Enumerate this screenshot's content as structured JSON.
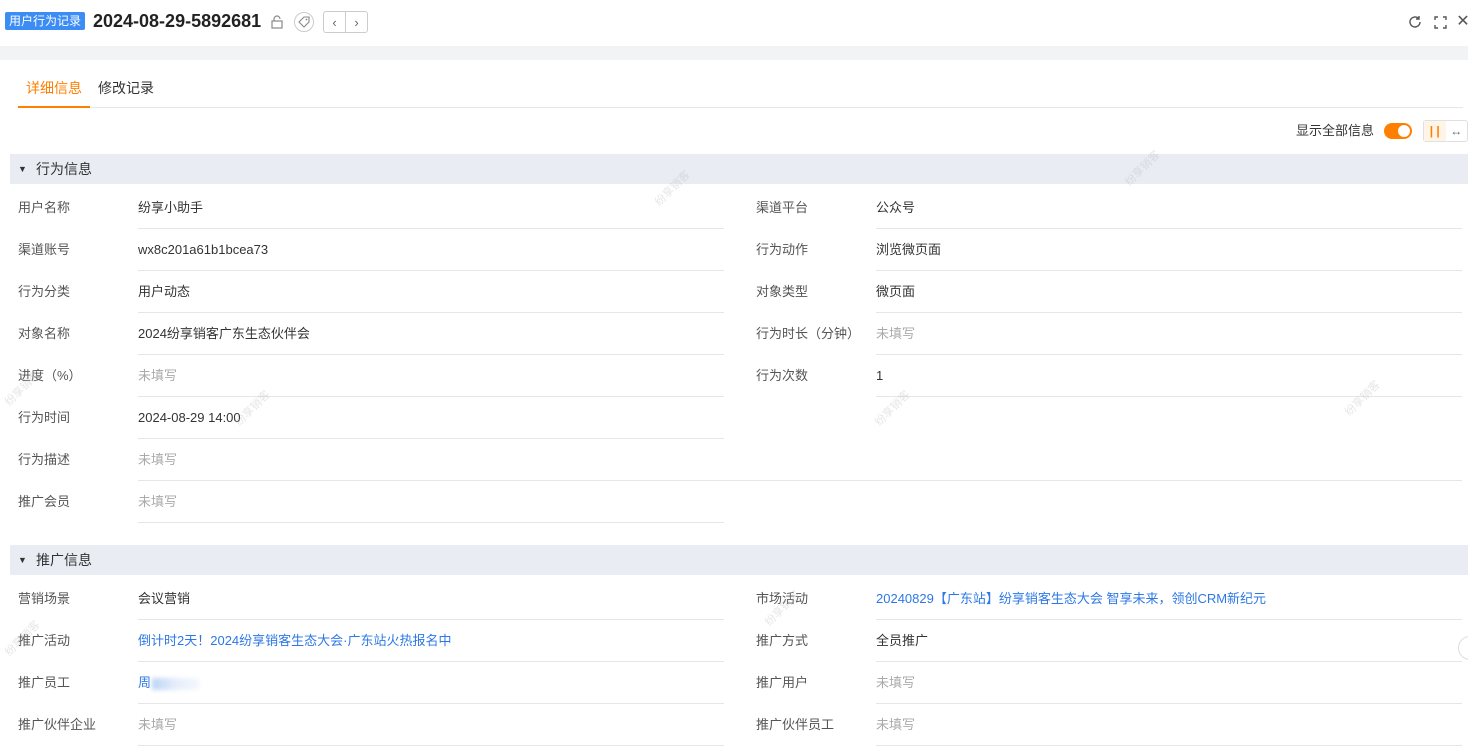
{
  "header": {
    "object_badge": "用户行为记录",
    "record_title": "2024-08-29-5892681"
  },
  "tabs": [
    {
      "label": "详细信息",
      "active": true
    },
    {
      "label": "修改记录",
      "active": false
    }
  ],
  "toolbar": {
    "show_all_label": "显示全部信息",
    "show_all_on": true
  },
  "sections": {
    "behavior": {
      "title": "行为信息",
      "left": [
        {
          "label": "用户名称",
          "value": "纷享小助手"
        },
        {
          "label": "渠道账号",
          "value": "wx8c201a61b1bcea73"
        },
        {
          "label": "行为分类",
          "value": "用户动态"
        },
        {
          "label": "对象名称",
          "value": "2024纷享销客广东生态伙伴会"
        },
        {
          "label": "进度（%）",
          "value": "未填写"
        },
        {
          "label": "行为时间",
          "value": "2024-08-29 14:00"
        },
        {
          "label": "行为描述",
          "value": "未填写"
        },
        {
          "label": "推广会员",
          "value": "未填写"
        }
      ],
      "right": [
        {
          "label": "渠道平台",
          "value": "公众号"
        },
        {
          "label": "行为动作",
          "value": "浏览微页面"
        },
        {
          "label": "对象类型",
          "value": "微页面"
        },
        {
          "label": "行为时长（分钟）",
          "value": "未填写"
        },
        {
          "label": "行为次数",
          "value": "1"
        }
      ]
    },
    "promotion": {
      "title": "推广信息",
      "left": [
        {
          "label": "营销场景",
          "value": "会议营销"
        },
        {
          "label": "推广活动",
          "value": "倒计时2天！2024纷享销客生态大会·广东站火热报名中"
        },
        {
          "label": "推广员工",
          "value": "周"
        },
        {
          "label": "推广伙伴企业",
          "value": "未填写"
        }
      ],
      "right": [
        {
          "label": "市场活动",
          "value": "20240829【广东站】纷享销客生态大会 智享未来，领创CRM新纪元"
        },
        {
          "label": "推广方式",
          "value": "全员推广"
        },
        {
          "label": "推广用户",
          "value": "未填写"
        },
        {
          "label": "推广伙伴员工",
          "value": "未填写"
        }
      ]
    }
  },
  "watermark": "纷享销客"
}
